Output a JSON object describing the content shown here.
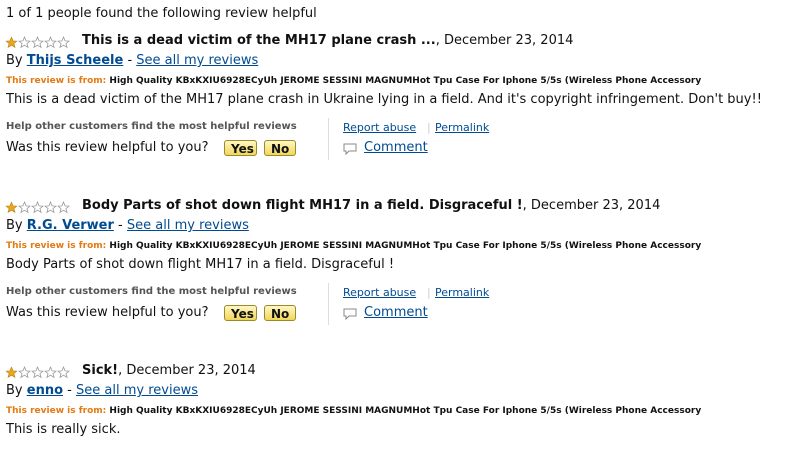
{
  "header": {
    "helpful_count": "1 of 1 people found the following review helpful"
  },
  "colors": {
    "link": "#004b91",
    "from_label": "#e47911",
    "star": "#e9a71b"
  },
  "reviews": [
    {
      "rating": 1,
      "title": "This is a dead victim of the MH17 plane crash ...",
      "date": ", December 23, 2014",
      "by": "By",
      "author": "Thijs Scheele",
      "dash": "-",
      "see_all": "See all my reviews",
      "from_label": "This review is from:",
      "product": "High Quality KBxKXIU6928ECyUh JEROME SESSINI MAGNUMHot Tpu Case For Iphone 5/5s (Wireless Phone Accessory",
      "body": "This is a dead victim of the MH17 plane crash in Ukraine lying in a field. And it's copyright infringement. Don't buy!!",
      "help_caption": "Help other customers find the most helpful reviews",
      "was_helpful": "Was this review helpful to you?",
      "yes": "Yes",
      "no": "No",
      "report_abuse": "Report abuse",
      "separator": "|",
      "permalink": "Permalink",
      "comment": "Comment"
    },
    {
      "rating": 1,
      "title": "Body Parts of shot down flight MH17 in a field. Disgraceful !",
      "date": ", December 23, 2014",
      "by": "By",
      "author": "R.G. Verwer",
      "dash": "-",
      "see_all": "See all my reviews",
      "from_label": "This review is from:",
      "product": "High Quality KBxKXIU6928ECyUh JEROME SESSINI MAGNUMHot Tpu Case For Iphone 5/5s (Wireless Phone Accessory",
      "body": "Body Parts of shot down flight MH17 in a field. Disgraceful !",
      "help_caption": "Help other customers find the most helpful reviews",
      "was_helpful": "Was this review helpful to you?",
      "yes": "Yes",
      "no": "No",
      "report_abuse": "Report abuse",
      "separator": "|",
      "permalink": "Permalink",
      "comment": "Comment"
    },
    {
      "rating": 1,
      "title": "Sick!",
      "date": ", December 23, 2014",
      "by": "By",
      "author": "enno",
      "dash": "-",
      "see_all": "See all my reviews",
      "from_label": "This review is from:",
      "product": "High Quality KBxKXIU6928ECyUh JEROME SESSINI MAGNUMHot Tpu Case For Iphone 5/5s (Wireless Phone Accessory",
      "body": "This is really sick."
    }
  ]
}
